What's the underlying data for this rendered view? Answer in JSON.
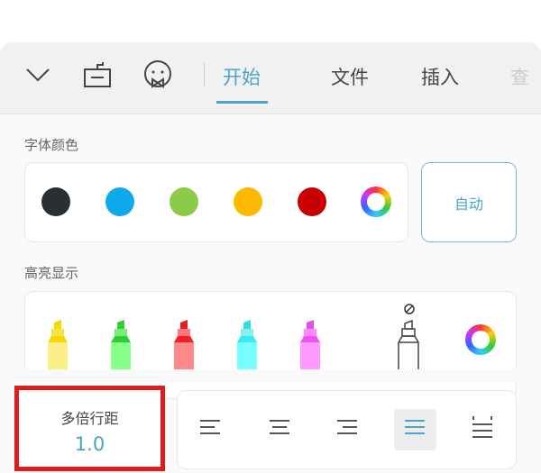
{
  "toolbar": {
    "icons": [
      "chevron-down-icon",
      "keyboard-icon",
      "emoji-icon"
    ],
    "tabs": [
      {
        "label": "开始",
        "active": true
      },
      {
        "label": "文件"
      },
      {
        "label": "插入"
      },
      {
        "label": "查"
      }
    ]
  },
  "font_color": {
    "label": "字体颜色",
    "colors": [
      "#2b2f33",
      "#10a8e8",
      "#8ccb4a",
      "#fcb900",
      "#c80000"
    ],
    "auto_label": "自动"
  },
  "highlight": {
    "label": "高亮显示",
    "colors": [
      "#f7e24a",
      "#55dd55",
      "#ee3333",
      "#44eeee",
      "#ee55ee"
    ]
  },
  "line_spacing": {
    "label": "多倍行距",
    "value": "1.0"
  },
  "alignment": {
    "options": [
      "align-left",
      "align-center",
      "align-right",
      "justify",
      "distribute"
    ],
    "selected": "justify"
  },
  "accent": "#4aa3c8"
}
